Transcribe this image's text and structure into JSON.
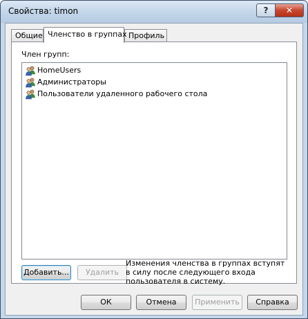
{
  "window": {
    "title": "Свойства: timon",
    "help_glyph": "?",
    "close_glyph": "✕"
  },
  "tabs": [
    {
      "label": "Общие",
      "active": false
    },
    {
      "label": "Членство в группах",
      "active": true
    },
    {
      "label": "Профиль",
      "active": false
    }
  ],
  "panel": {
    "groups_label": "Член групп:",
    "groups": [
      {
        "name": "HomeUsers",
        "icon": "user-group-icon"
      },
      {
        "name": "Администраторы",
        "icon": "user-group-icon"
      },
      {
        "name": "Пользователи удаленного рабочего стола",
        "icon": "user-group-icon"
      }
    ],
    "add_button": "Добавить...",
    "remove_button": "Удалить",
    "note": "Изменения членства в группах вступят в силу после следующего входа пользователя в систему."
  },
  "footer": {
    "ok": "ОК",
    "cancel": "Отмена",
    "apply": "Применить",
    "help": "Справка"
  },
  "colors": {
    "titlebar": "#c6d7e9",
    "close_button": "#c7452c",
    "dialog_face": "#f0f0f0"
  }
}
